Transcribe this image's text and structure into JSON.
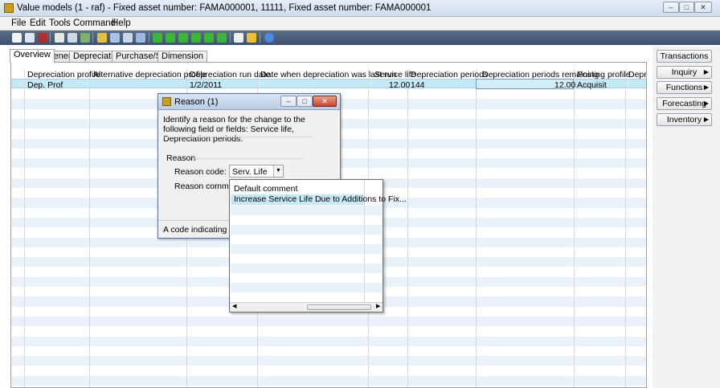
{
  "window": {
    "title": "Value models (1 - raf) - Fixed asset number: FAMA000001, 11111, Fixed asset number: FAMA000001"
  },
  "menu": {
    "items": [
      "File",
      "Edit",
      "Tools",
      "Command",
      "Help"
    ]
  },
  "tabs": [
    "Overview",
    "General",
    "Depreciation",
    "Purchase/Sale",
    "Dimension"
  ],
  "grid": {
    "columns": [
      "Depreciation profile",
      "Alternative depreciation profile",
      "Depreciation run date",
      "Date when depreciation was last run",
      "Service life",
      "Depreciation periods",
      "Depreciation periods remaining",
      "Posting profile",
      "Depre"
    ],
    "row": {
      "depreciation_profile": "Dep. Prof",
      "alternative_profile": "",
      "run_date": "1/2/2011",
      "last_run": "",
      "service_life": "12.00",
      "depreciation_periods": "144",
      "periods_remaining": "12.00",
      "posting_profile": "Acquisit"
    }
  },
  "actions": {
    "transactions": "Transactions",
    "inquiry": "Inquiry",
    "functions": "Functions",
    "forecasting": "Forecasting",
    "inventory": "Inventory"
  },
  "dialog": {
    "title": "Reason (1)",
    "instruction": "Identify a reason for the change to the following field or fields: Service life, Depreciation periods.",
    "group_label": "Reason",
    "reason_code_label": "Reason code:",
    "reason_code_value": "Serv. Life",
    "reason_comment_label": "Reason comment:",
    "status_text": "A code indicating a reas"
  },
  "lookup": {
    "header": "Default comment",
    "items": [
      "Increase Service Life Due to Additions to Fix..."
    ]
  },
  "colors": {
    "selected_row": "#c6e8f7",
    "alt_row": "#e9f1fb",
    "toolbar": "#4a5e7c"
  }
}
